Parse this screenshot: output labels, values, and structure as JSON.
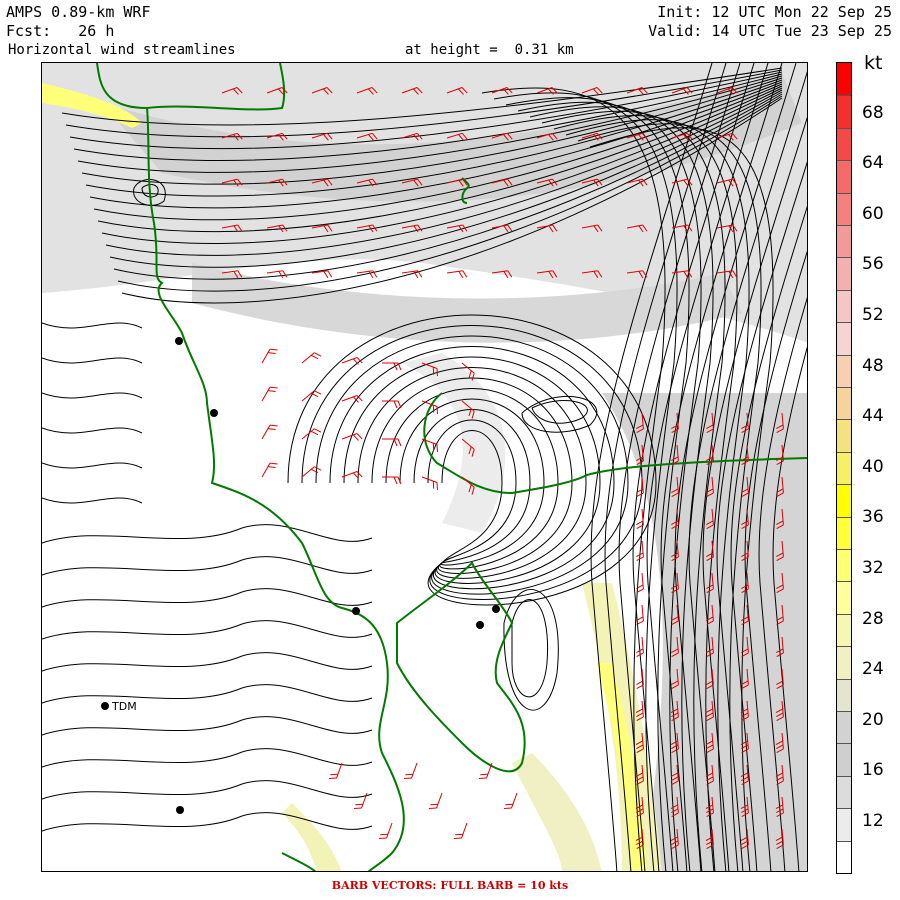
{
  "header": {
    "model": "AMPS 0.89-km WRF",
    "init": "Init: 12 UTC Mon 22 Sep 25",
    "forecast": "Fcst:   26 h",
    "valid": "Valid: 14 UTC Tue 23 Sep 25",
    "field": "Horizontal wind streamlines",
    "height": "at height =  0.31 km"
  },
  "colorbar": {
    "unit": "kt",
    "tick_labels": [
      "12",
      "16",
      "20",
      "24",
      "28",
      "32",
      "36",
      "40",
      "44",
      "48",
      "52",
      "56",
      "60",
      "64",
      "68"
    ],
    "segment_colors": [
      "#ffffff",
      "#ececec",
      "#dcdcdc",
      "#cfcfcf",
      "#d2d2d2",
      "#e4e4cf",
      "#f0f0c4",
      "#f7f7b4",
      "#ffff9c",
      "#ffff72",
      "#ffff3a",
      "#ffff00",
      "#f7f066",
      "#f3e27e",
      "#f4d49a",
      "#f7cfb2",
      "#f6d4d4",
      "#f5c6c6",
      "#f3b0b0",
      "#f29a9a",
      "#f48080",
      "#f56a6a",
      "#f54848",
      "#f52e2e",
      "#ff0000"
    ]
  },
  "stations": [
    {
      "label": "TDM"
    }
  ],
  "colors": {
    "coastline": "#007a00",
    "barbs": "#e00000",
    "streamlines": "#000000"
  },
  "footer": "BARB VECTORS:  FULL BARB = 10 kts"
}
